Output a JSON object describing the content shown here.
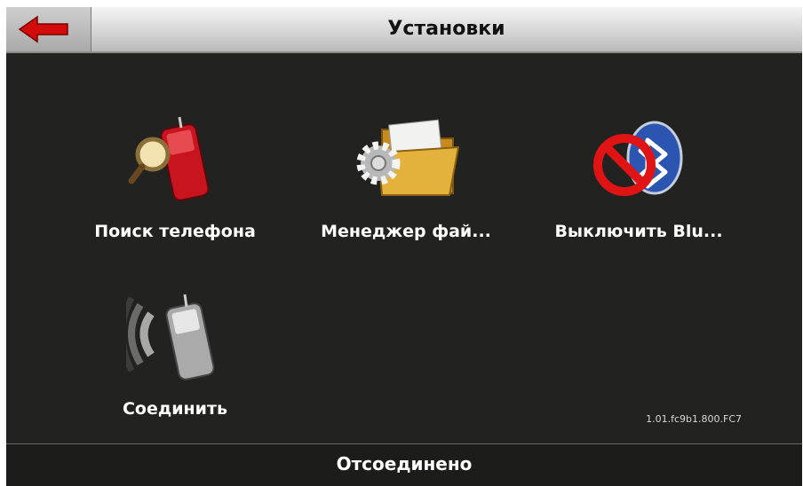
{
  "header": {
    "title": "Установки",
    "back_icon": "back-arrow-icon"
  },
  "tiles": [
    {
      "label": "Поиск телефона",
      "icon": "phone-search-icon"
    },
    {
      "label": "Менеджер фай...",
      "icon": "file-manager-icon"
    },
    {
      "label": "Выключить Blu...",
      "icon": "bluetooth-off-icon"
    },
    {
      "label": "Соединить",
      "icon": "phone-connect-icon"
    }
  ],
  "version": "1.01.fc9b1.800.FC7",
  "status": {
    "text": "Отсоединено"
  },
  "colors": {
    "accent": "#d40b0b",
    "background": "#222220",
    "text": "#ffffff"
  }
}
